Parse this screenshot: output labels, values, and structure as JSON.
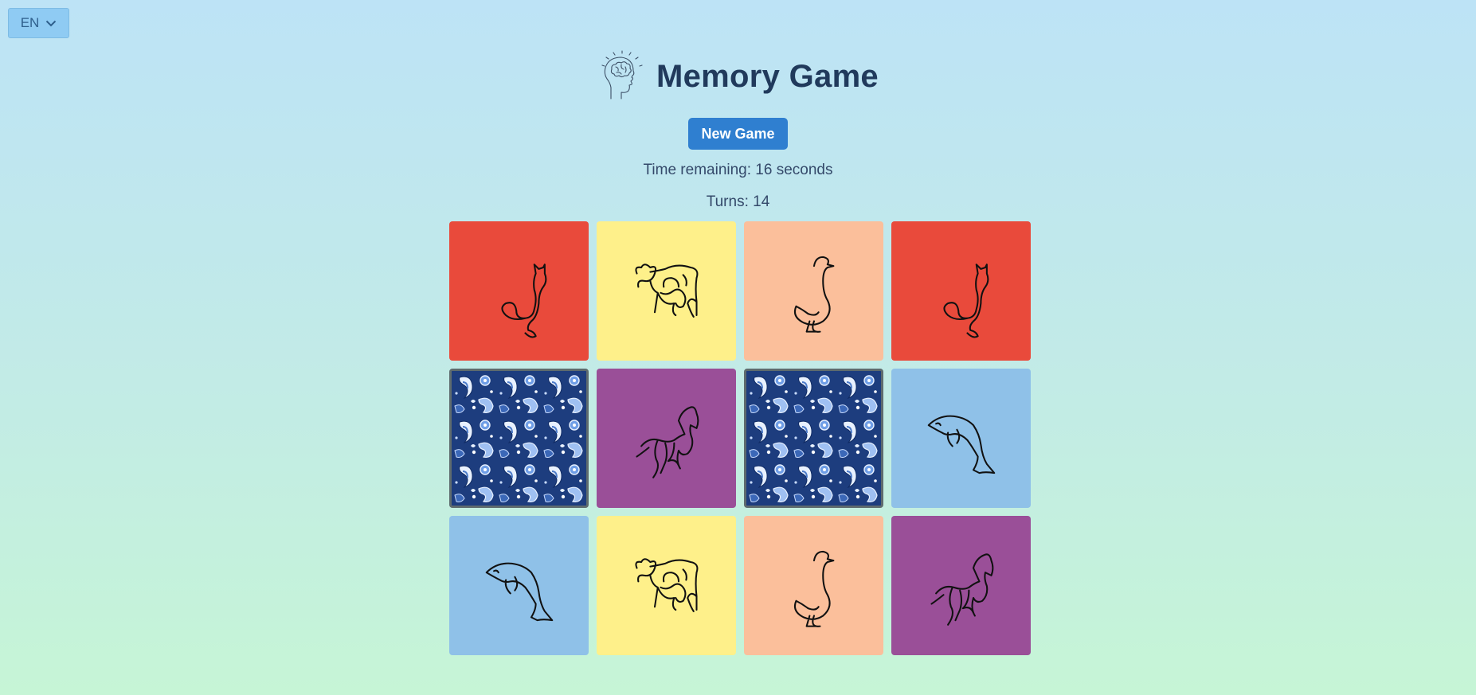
{
  "language": {
    "selected": "EN"
  },
  "header": {
    "title": "Memory Game"
  },
  "controls": {
    "new_game_label": "New Game"
  },
  "status": {
    "time_remaining_text": "Time remaining: 16 seconds",
    "turns_text": "Turns: 14"
  },
  "colors": {
    "red": "#e94a3b",
    "yellow": "#fef08a",
    "peach": "#fbbf9b",
    "purple": "#9a4f98",
    "blue": "#8fc1e8",
    "button": "#2f7fd0"
  },
  "cards": [
    {
      "state": "revealed",
      "animal": "cat-icon",
      "color": "#e94a3b"
    },
    {
      "state": "revealed",
      "animal": "cow-icon",
      "color": "#fef08a"
    },
    {
      "state": "revealed",
      "animal": "goose-icon",
      "color": "#fbbf9b"
    },
    {
      "state": "revealed",
      "animal": "cat-icon",
      "color": "#e94a3b"
    },
    {
      "state": "hidden",
      "animal": "paisley-card-back",
      "color": "#1d3d7e"
    },
    {
      "state": "revealed",
      "animal": "horse-icon",
      "color": "#9a4f98"
    },
    {
      "state": "hidden",
      "animal": "paisley-card-back",
      "color": "#1d3d7e"
    },
    {
      "state": "revealed",
      "animal": "dolphin-icon",
      "color": "#8fc1e8"
    },
    {
      "state": "revealed",
      "animal": "dolphin-icon",
      "color": "#8fc1e8"
    },
    {
      "state": "revealed",
      "animal": "cow-icon",
      "color": "#fef08a"
    },
    {
      "state": "revealed",
      "animal": "goose-icon",
      "color": "#fbbf9b"
    },
    {
      "state": "revealed",
      "animal": "horse-icon",
      "color": "#9a4f98"
    }
  ]
}
